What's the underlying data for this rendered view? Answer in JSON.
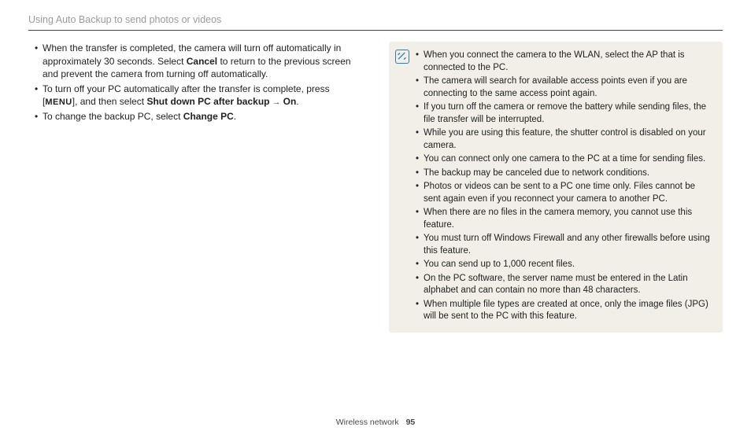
{
  "header": {
    "title": "Using Auto Backup to send photos or videos"
  },
  "left": {
    "items": [
      {
        "pre": "When the transfer is completed, the camera will turn off automatically in approximately 30 seconds. Select ",
        "b1": "Cancel",
        "post": " to return to the previous screen and prevent the camera from turning off automatically."
      },
      {
        "pre": "To turn off your PC automatically after the transfer is complete, press [",
        "menu": "MENU",
        "mid": "], and then select ",
        "b1": "Shut down PC after backup",
        "arrow": " → ",
        "b2": "On",
        "post": "."
      },
      {
        "pre": "To change the backup PC, select ",
        "b1": "Change PC",
        "post": "."
      }
    ]
  },
  "notes": {
    "items": [
      "When you connect the camera to the WLAN, select the AP that is connected to the PC.",
      "The camera will search for available access points even if you are connecting to the same access point again.",
      "If you turn off the camera or remove the battery while sending files, the file transfer will be interrupted.",
      "While you are using this feature, the shutter control is disabled on your camera.",
      "You can connect only one camera to the PC at a time for sending files.",
      "The backup may be canceled due to network conditions.",
      "Photos or videos can be sent to a PC one time only. Files cannot be sent again even if you reconnect your camera to another PC.",
      "When there are no files in the camera memory, you cannot use this feature.",
      "You must turn off Windows Firewall and any other firewalls before using this feature.",
      "You can send up to 1,000 recent files.",
      "On the PC software, the server name must be entered in the Latin alphabet and can contain no more than 48 characters.",
      "When multiple file types are created at once, only the image files (JPG) will be sent to the PC with this feature."
    ]
  },
  "footer": {
    "section": "Wireless network",
    "page": "95"
  }
}
